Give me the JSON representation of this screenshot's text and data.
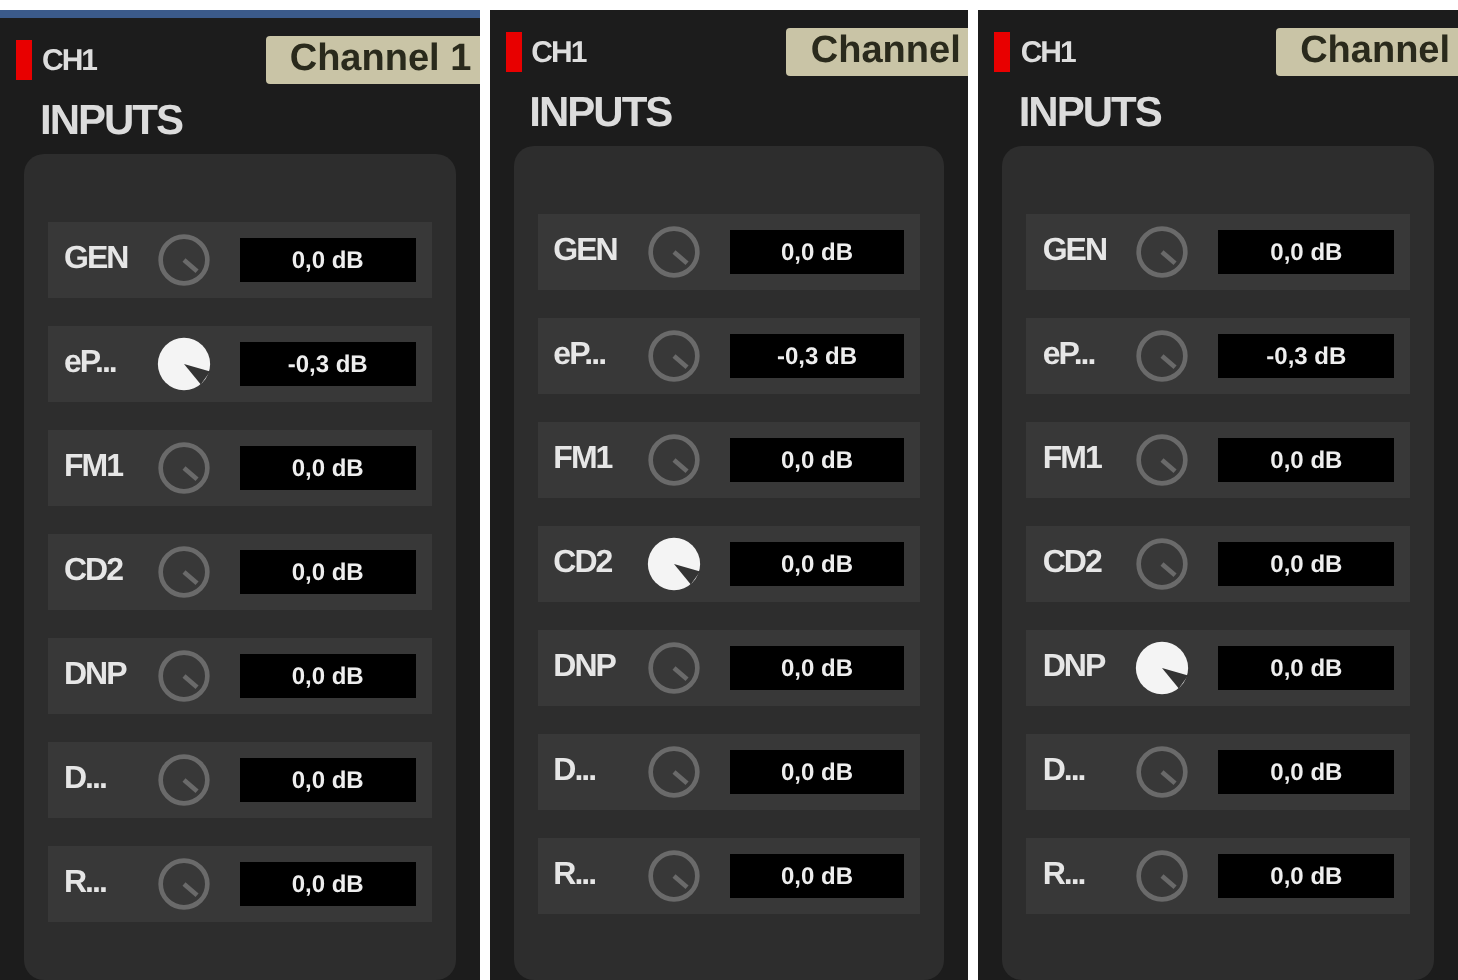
{
  "panels": [
    {
      "led": "CH1",
      "channel_name": "Channel 1",
      "section_title": "INPUTS",
      "inputs": [
        {
          "label": "GEN",
          "value": "0,0 dB",
          "active": false
        },
        {
          "label": "eP...",
          "value": "-0,3 dB",
          "active": true
        },
        {
          "label": "FM1",
          "value": "0,0 dB",
          "active": false
        },
        {
          "label": "CD2",
          "value": "0,0 dB",
          "active": false
        },
        {
          "label": "DNP",
          "value": "0,0 dB",
          "active": false
        },
        {
          "label": "D...",
          "value": "0,0 dB",
          "active": false
        },
        {
          "label": "R...",
          "value": "0,0 dB",
          "active": false
        }
      ]
    },
    {
      "led": "CH1",
      "channel_name": "Channel",
      "section_title": "INPUTS",
      "inputs": [
        {
          "label": "GEN",
          "value": "0,0 dB",
          "active": false
        },
        {
          "label": "eP...",
          "value": "-0,3 dB",
          "active": false
        },
        {
          "label": "FM1",
          "value": "0,0 dB",
          "active": false
        },
        {
          "label": "CD2",
          "value": "0,0 dB",
          "active": true
        },
        {
          "label": "DNP",
          "value": "0,0 dB",
          "active": false
        },
        {
          "label": "D...",
          "value": "0,0 dB",
          "active": false
        },
        {
          "label": "R...",
          "value": "0,0 dB",
          "active": false
        }
      ]
    },
    {
      "led": "CH1",
      "channel_name": "Channel",
      "section_title": "INPUTS",
      "inputs": [
        {
          "label": "GEN",
          "value": "0,0 dB",
          "active": false
        },
        {
          "label": "eP...",
          "value": "-0,3 dB",
          "active": false
        },
        {
          "label": "FM1",
          "value": "0,0 dB",
          "active": false
        },
        {
          "label": "CD2",
          "value": "0,0 dB",
          "active": false
        },
        {
          "label": "DNP",
          "value": "0,0 dB",
          "active": true
        },
        {
          "label": "D...",
          "value": "0,0 dB",
          "active": false
        },
        {
          "label": "R...",
          "value": "0,0 dB",
          "active": false
        }
      ]
    }
  ]
}
